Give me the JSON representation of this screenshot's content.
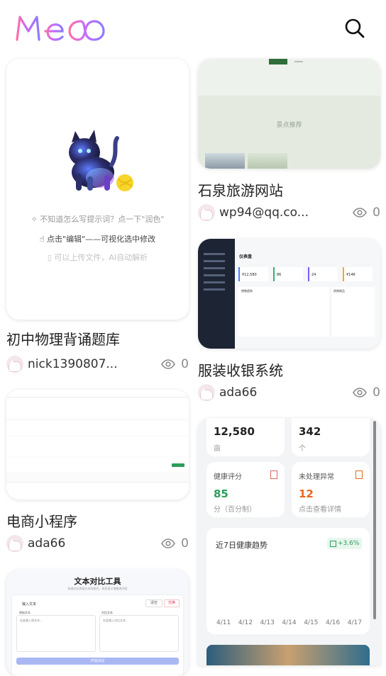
{
  "app": {
    "logo_text": "Meoo"
  },
  "cards": [
    {
      "title": "初中物理背诵题库",
      "author": "nick1390807...",
      "views": "0",
      "preview": {
        "hints": [
          "不知道怎么写提示词？点一下\"润色\"",
          "点击\"编辑\"——可视化选中修改",
          "可以上传文件，AI自动解析"
        ]
      }
    },
    {
      "title": "石泉旅游网站",
      "author": "wp94@qq.co...",
      "views": "0",
      "preview": {
        "heading": "景点推荐"
      }
    },
    {
      "title": "服装收银系统",
      "author": "ada66",
      "views": "0",
      "preview": {
        "page_title": "仪表盘",
        "stats": [
          "¥12,580",
          "86",
          "24",
          "¥146"
        ],
        "section_left": "销售趋势",
        "section_right": "热销商品"
      }
    },
    {
      "title": "电商小程序",
      "author": "ada66",
      "views": "0",
      "preview": {}
    },
    {
      "title": "文本对比工具",
      "preview": {
        "subtitle": "快速对比两段文本的差异，高亮显示增删改内容",
        "input_label": "输入文本",
        "clear": "清空",
        "swap": "交换",
        "text_a_label": "原始文本",
        "text_b_label": "对比文本",
        "text_a_placeholder": "在此输入原文本...",
        "text_b_placeholder": "在此输入对比文本...",
        "compare": "开始对比"
      }
    },
    {
      "title": "",
      "preview": {
        "stat1_value": "12,580",
        "stat1_unit": "亩",
        "stat2_value": "342",
        "stat2_unit": "个",
        "health_label": "健康评分",
        "health_value": "85",
        "health_unit": "分（百分制）",
        "abnormal_label": "未处理异常",
        "abnormal_value": "12",
        "abnormal_hint": "点击查看详情",
        "trend_title": "近7日健康趋势",
        "trend_badge": "+3.6%",
        "trend_days": [
          "4/11",
          "4/12",
          "4/13",
          "4/14",
          "4/15",
          "4/16",
          "4/17"
        ]
      }
    }
  ],
  "colors": {
    "logo_start": "#ff6fa8",
    "logo_end": "#8c7bff",
    "green": "#2e9d5a",
    "orange": "#e8681e"
  }
}
